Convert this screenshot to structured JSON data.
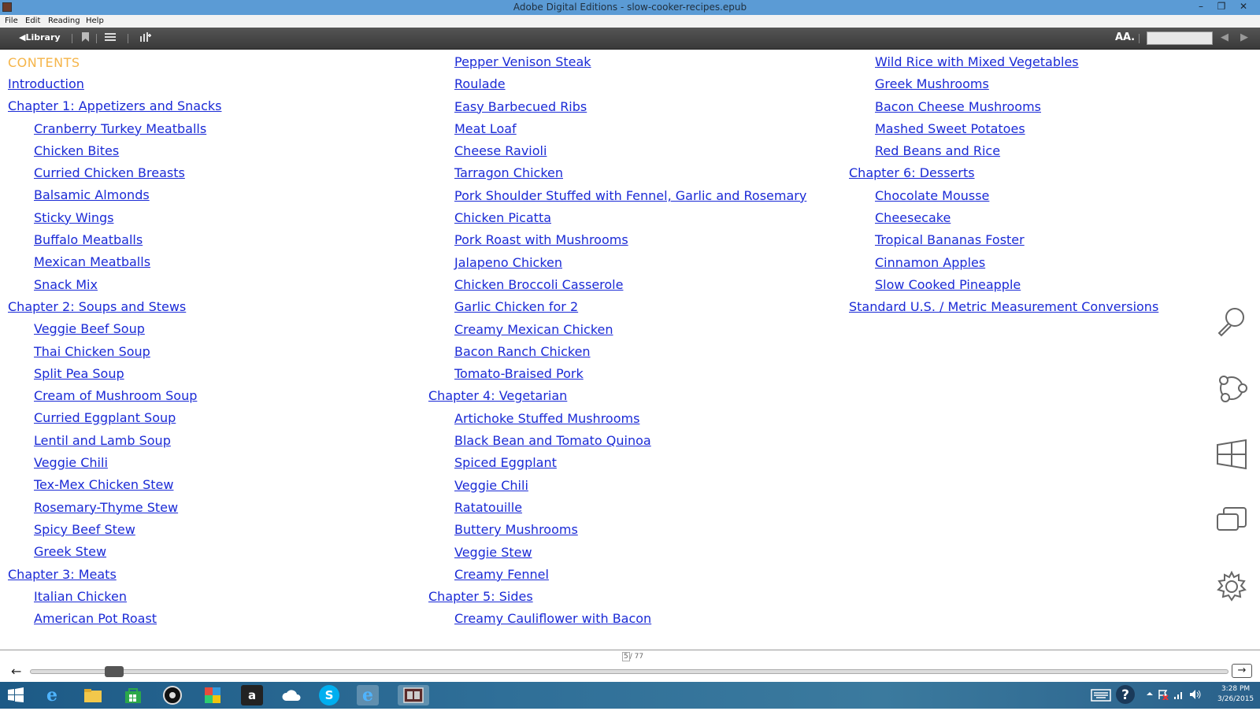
{
  "window": {
    "title": "Adobe Digital Editions - slow-cooker-recipes.epub",
    "min": "–",
    "restore": "❐",
    "close": "✕"
  },
  "menu": {
    "file": "File",
    "edit": "Edit",
    "reading": "Reading",
    "help": "Help"
  },
  "toolbar": {
    "library": "◀Library",
    "font_size": "AΑ.",
    "prev": "◀",
    "next": "▶"
  },
  "toc": {
    "heading": "CONTENTS",
    "col1": [
      {
        "label": "Introduction",
        "level": "chapter"
      },
      {
        "label": "Chapter 1: Appetizers and Snacks",
        "level": "chapter"
      },
      {
        "label": "Cranberry Turkey Meatballs",
        "level": "sub"
      },
      {
        "label": "Chicken Bites",
        "level": "sub"
      },
      {
        "label": "Curried Chicken Breasts",
        "level": "sub"
      },
      {
        "label": "Balsamic Almonds",
        "level": "sub"
      },
      {
        "label": "Sticky Wings",
        "level": "sub"
      },
      {
        "label": "Buffalo Meatballs",
        "level": "sub"
      },
      {
        "label": "Mexican Meatballs",
        "level": "sub"
      },
      {
        "label": "Snack Mix",
        "level": "sub"
      },
      {
        "label": "Chapter 2: Soups and Stews",
        "level": "chapter"
      },
      {
        "label": "Veggie Beef Soup",
        "level": "sub"
      },
      {
        "label": "Thai Chicken Soup",
        "level": "sub"
      },
      {
        "label": "Split Pea Soup",
        "level": "sub"
      },
      {
        "label": "Cream of Mushroom Soup",
        "level": "sub"
      },
      {
        "label": "Curried Eggplant Soup",
        "level": "sub"
      },
      {
        "label": "Lentil and Lamb Soup",
        "level": "sub"
      },
      {
        "label": "Veggie Chili",
        "level": "sub"
      },
      {
        "label": "Tex-Mex Chicken Stew",
        "level": "sub"
      },
      {
        "label": "Rosemary-Thyme Stew",
        "level": "sub"
      },
      {
        "label": "Spicy Beef Stew",
        "level": "sub"
      },
      {
        "label": "Greek Stew",
        "level": "sub"
      },
      {
        "label": "Chapter 3: Meats",
        "level": "chapter"
      },
      {
        "label": "Italian Chicken",
        "level": "sub"
      },
      {
        "label": "American Pot Roast",
        "level": "sub"
      }
    ],
    "col2": [
      {
        "label": "Pepper Venison Steak",
        "level": "sub"
      },
      {
        "label": "Roulade",
        "level": "sub"
      },
      {
        "label": "Easy Barbecued Ribs",
        "level": "sub"
      },
      {
        "label": "Meat Loaf",
        "level": "sub"
      },
      {
        "label": "Cheese Ravioli",
        "level": "sub"
      },
      {
        "label": "Tarragon Chicken",
        "level": "sub"
      },
      {
        "label": "Pork Shoulder Stuffed with Fennel, Garlic and Rosemary",
        "level": "sub"
      },
      {
        "label": "Chicken Picatta",
        "level": "sub"
      },
      {
        "label": "Pork Roast with Mushrooms",
        "level": "sub"
      },
      {
        "label": "Jalapeno Chicken",
        "level": "sub"
      },
      {
        "label": "Chicken Broccoli Casserole",
        "level": "sub"
      },
      {
        "label": "Garlic Chicken for 2",
        "level": "sub"
      },
      {
        "label": "Creamy Mexican Chicken",
        "level": "sub"
      },
      {
        "label": "Bacon Ranch Chicken",
        "level": "sub"
      },
      {
        "label": "Tomato-Braised Pork",
        "level": "sub"
      },
      {
        "label": "Chapter 4: Vegetarian",
        "level": "chapter"
      },
      {
        "label": "Artichoke Stuffed Mushrooms",
        "level": "sub"
      },
      {
        "label": "Black Bean and Tomato Quinoa",
        "level": "sub"
      },
      {
        "label": "Spiced Eggplant",
        "level": "sub"
      },
      {
        "label": "Veggie Chili",
        "level": "sub"
      },
      {
        "label": "Ratatouille",
        "level": "sub"
      },
      {
        "label": "Buttery Mushrooms",
        "level": "sub"
      },
      {
        "label": "Veggie Stew",
        "level": "sub"
      },
      {
        "label": "Creamy Fennel",
        "level": "sub"
      },
      {
        "label": "Chapter 5: Sides",
        "level": "chapter"
      },
      {
        "label": "Creamy Cauliflower with Bacon",
        "level": "sub"
      }
    ],
    "col3": [
      {
        "label": "Wild Rice with Mixed Vegetables",
        "level": "sub"
      },
      {
        "label": "Greek Mushrooms",
        "level": "sub"
      },
      {
        "label": "Bacon Cheese Mushrooms",
        "level": "sub"
      },
      {
        "label": "Mashed Sweet Potatoes",
        "level": "sub"
      },
      {
        "label": "Red Beans and Rice",
        "level": "sub"
      },
      {
        "label": "Chapter 6: Desserts",
        "level": "chapter"
      },
      {
        "label": "Chocolate Mousse",
        "level": "sub"
      },
      {
        "label": "Cheesecake",
        "level": "sub"
      },
      {
        "label": "Tropical Bananas Foster",
        "level": "sub"
      },
      {
        "label": "Cinnamon Apples",
        "level": "sub"
      },
      {
        "label": "Slow Cooked Pineapple",
        "level": "sub"
      },
      {
        "label": "Standard U.S. / Metric Measurement Conversions",
        "level": "chapter"
      }
    ]
  },
  "pager": {
    "current": "5",
    "total": "/ 77",
    "progress": 0.056,
    "back": "←",
    "forward": "→"
  },
  "charms": [
    "search-icon",
    "share-icon",
    "start-icon",
    "devices-icon",
    "settings-icon"
  ],
  "taskbar": {
    "apps": [
      "start",
      "internet-explorer",
      "file-explorer",
      "store",
      "media",
      "photos",
      "amazon",
      "onedrive",
      "skype",
      "internet-explorer-2",
      "digital-editions"
    ],
    "amazon_label": "a",
    "skype_label": "S",
    "ie_label": "e",
    "time": "3:28 PM",
    "date": "3/26/2015"
  },
  "colors": {
    "link": "#1a2ad6",
    "heading": "#f5b54a",
    "titlebar": "#5b9bd5"
  }
}
